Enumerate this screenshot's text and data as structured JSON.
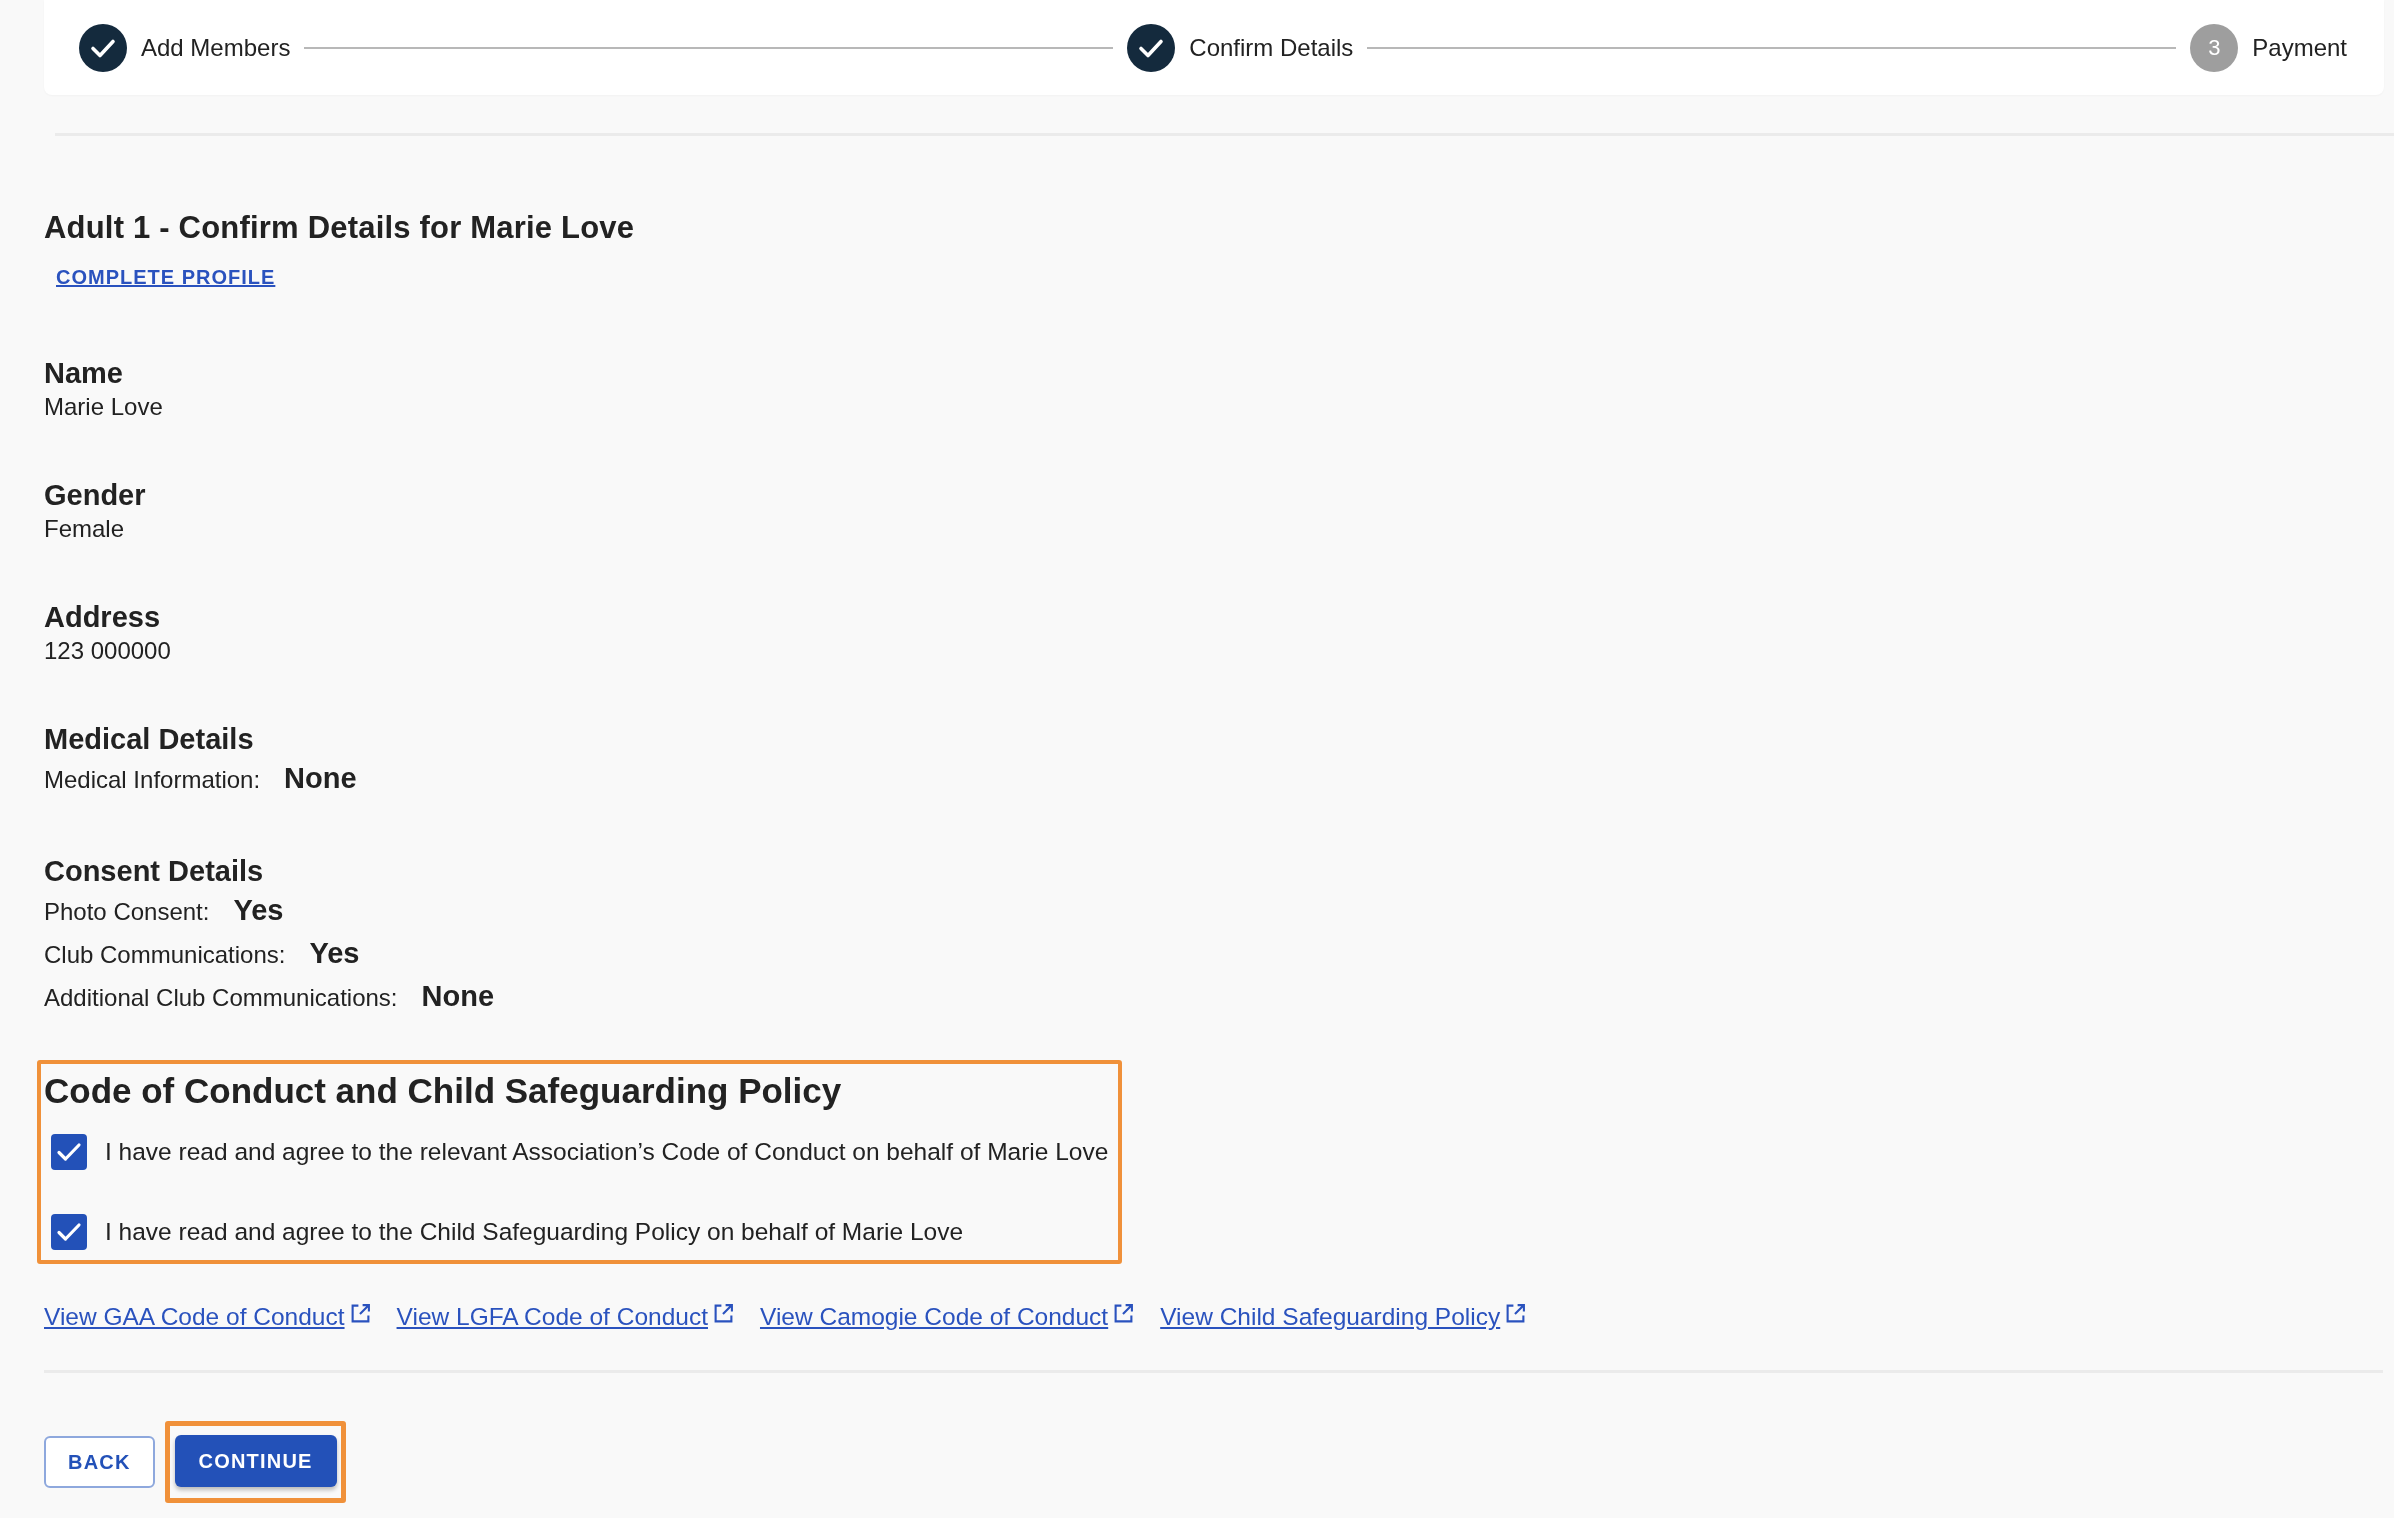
{
  "stepper": {
    "steps": [
      {
        "label": "Add Members",
        "completed": true
      },
      {
        "label": "Confirm Details",
        "completed": true
      },
      {
        "label": "Payment",
        "completed": false,
        "number": "3"
      }
    ]
  },
  "heading": "Adult 1 - Confirm Details for Marie Love",
  "complete_profile_link": "COMPLETE PROFILE",
  "sections": [
    {
      "kind": "text",
      "title": "Name",
      "value": "Marie Love"
    },
    {
      "kind": "text",
      "title": "Gender",
      "value": "Female"
    },
    {
      "kind": "text",
      "title": "Address",
      "value": "123 000000"
    },
    {
      "kind": "pairs",
      "title": "Medical Details",
      "rows": [
        {
          "label": "Medical Information:",
          "value": "None"
        }
      ]
    },
    {
      "kind": "pairs",
      "title": "Consent Details",
      "rows": [
        {
          "label": "Photo Consent:",
          "value": "Yes"
        },
        {
          "label": "Club Communications:",
          "value": "Yes"
        },
        {
          "label": "Additional Club Communications:",
          "value": "None"
        }
      ]
    }
  ],
  "conduct": {
    "title": "Code of Conduct and Child Safeguarding Policy",
    "highlighted": true,
    "items": [
      {
        "label": "I have read and agree to the relevant Association’s Code of Conduct on behalf of Marie Love",
        "checked": true
      },
      {
        "label": "I have read and agree to the Child Safeguarding Policy on behalf of Marie Love",
        "checked": true
      }
    ]
  },
  "links": [
    {
      "label": "View GAA Code of Conduct"
    },
    {
      "label": "View LGFA Code of Conduct"
    },
    {
      "label": "View Camogie Code of Conduct"
    },
    {
      "label": "View Child Safeguarding Policy"
    }
  ],
  "buttons": [
    {
      "label": "BACK",
      "kind": "outlined",
      "highlighted": false
    },
    {
      "label": "CONTINUE",
      "kind": "contained",
      "highlighted": true
    }
  ]
}
